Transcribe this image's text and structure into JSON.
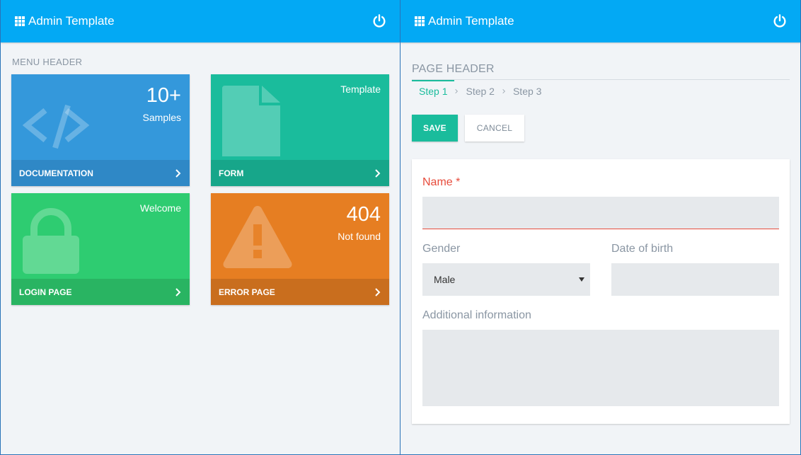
{
  "left": {
    "topbar": {
      "title": "Admin Template"
    },
    "menu_header": "MENU HEADER",
    "tiles": [
      {
        "stat": "10+",
        "label": "Samples",
        "footer": "DOCUMENTATION",
        "color": "#3498db",
        "footer_color": "#2f88c6",
        "icon": "code-icon"
      },
      {
        "stat": "",
        "label": "Template",
        "footer": "FORM",
        "color": "#1abc9c",
        "footer_color": "#17a68a",
        "icon": "file-icon"
      },
      {
        "stat": "",
        "label": "Welcome",
        "footer": "LOGIN PAGE",
        "color": "#2ecc71",
        "footer_color": "#29b462",
        "icon": "lock-icon"
      },
      {
        "stat": "404",
        "label": "Not found",
        "footer": "ERROR PAGE",
        "color": "#e67e22",
        "footer_color": "#c96e1e",
        "icon": "warning-icon"
      }
    ]
  },
  "right": {
    "topbar": {
      "title": "Admin Template"
    },
    "page_header": "PAGE HEADER",
    "steps": [
      "Step 1",
      "Step 2",
      "Step 3"
    ],
    "active_step": "Step 1",
    "buttons": {
      "save": "SAVE",
      "cancel": "CANCEL"
    },
    "form": {
      "name_label": "Name *",
      "name_value": "",
      "gender_label": "Gender",
      "gender_value": "Male",
      "dob_label": "Date of birth",
      "dob_value": "",
      "info_label": "Additional information",
      "info_value": ""
    }
  },
  "colors": {
    "topbar": "#03a9f4",
    "accent": "#1abc9c",
    "required": "#e74c3c"
  }
}
